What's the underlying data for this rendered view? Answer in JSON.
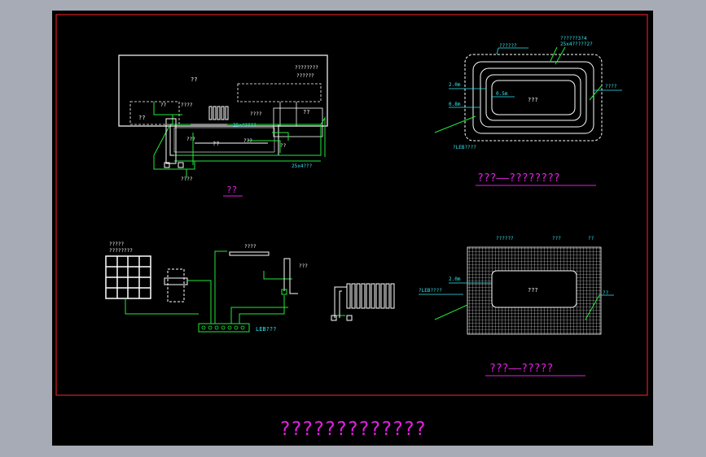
{
  "colors": {
    "frame": "#d0202a",
    "white": "#ffffff",
    "green": "#22e83a",
    "cyan": "#33e6f0",
    "magenta": "#e020e0",
    "bg": "#000000",
    "gray_bg": "#a6abb5"
  },
  "sheet_title": "?????????????",
  "plan": {
    "caption": "??",
    "room_label": "??",
    "label_tr1": "????????",
    "label_tr2": "??????",
    "label_left1": "??",
    "label_left2": "??",
    "label_mid": "???",
    "label_center": "??",
    "label_right": "??",
    "label_c1": "????",
    "label_c2": "????",
    "label_pipe1": "25x4????",
    "label_pipe2": "???",
    "label_pipe3": "??",
    "label_pipe4": "????",
    "label_pipe5": "25x4???",
    "label_pipe6": "????"
  },
  "detail_a": {
    "caption": "???——????????",
    "label_top1": "??????",
    "label_top2": "??????3?4",
    "label_top3": "25x4?????2?",
    "label_left1": "2.0m",
    "label_left2": "0.8m",
    "label_inner": "0.5m",
    "label_center": "???",
    "label_right": "????",
    "label_bottom": "?LEB????"
  },
  "detail_b": {
    "caption": "???——?????",
    "label_top1": "??????",
    "label_top2": "???",
    "label_top3": "??",
    "label_left1": "2.0m",
    "label_left2": "?LEB????",
    "label_center": "???",
    "label_right": "??"
  },
  "schematic": {
    "label_grid1": "?????",
    "label_grid2": "????????",
    "label_top": "????",
    "label_right": "???",
    "label_box": "LEB???"
  }
}
